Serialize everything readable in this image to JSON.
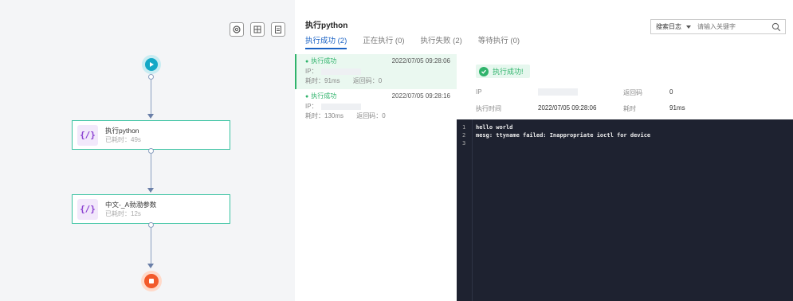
{
  "flow": {
    "tasks": [
      {
        "name": "执行python",
        "elapsed": "已耗时：49s",
        "icon_text": "{/}"
      },
      {
        "name": "中文-_A勃渤参数",
        "elapsed": "已耗时：12s",
        "icon_text": "{/}"
      }
    ]
  },
  "panel": {
    "title": "执行python",
    "tabs": [
      {
        "label": "执行成功 (2)",
        "active": true
      },
      {
        "label": "正在执行 (0)",
        "active": false
      },
      {
        "label": "执行失败 (2)",
        "active": false
      },
      {
        "label": "等待执行 (0)",
        "active": false
      }
    ],
    "search": {
      "select_label": "搜索日志",
      "placeholder": "请输入关键字"
    }
  },
  "executions": [
    {
      "status": "执行成功",
      "date": "2022/07/05 09:28:06",
      "ip_label": "IP：",
      "duration": "耗时：91ms",
      "code": "返回码：0"
    },
    {
      "status": "执行成功",
      "date": "2022/07/05 09:28:16",
      "ip_label": "IP：",
      "duration": "耗时：130ms",
      "code": "返回码：0"
    }
  ],
  "detail": {
    "badge": "执行成功!",
    "ip_label": "IP",
    "code_label": "返回码",
    "code_value": "0",
    "time_label": "执行时间",
    "time_value": "2022/07/05 09:28:06",
    "duration_label": "耗时",
    "duration_value": "91ms"
  },
  "console": {
    "lines": [
      {
        "n": "1",
        "text": "hello world"
      },
      {
        "n": "2",
        "text": "mesg: ttyname failed: Inappropriate ioctl for device"
      },
      {
        "n": "3",
        "text": ""
      }
    ]
  },
  "colors": {
    "accent": "#1a62c4",
    "success": "#2fb36b",
    "start": "#13a8c6",
    "end": "#f25a2b",
    "console_bg": "#1e2230"
  }
}
